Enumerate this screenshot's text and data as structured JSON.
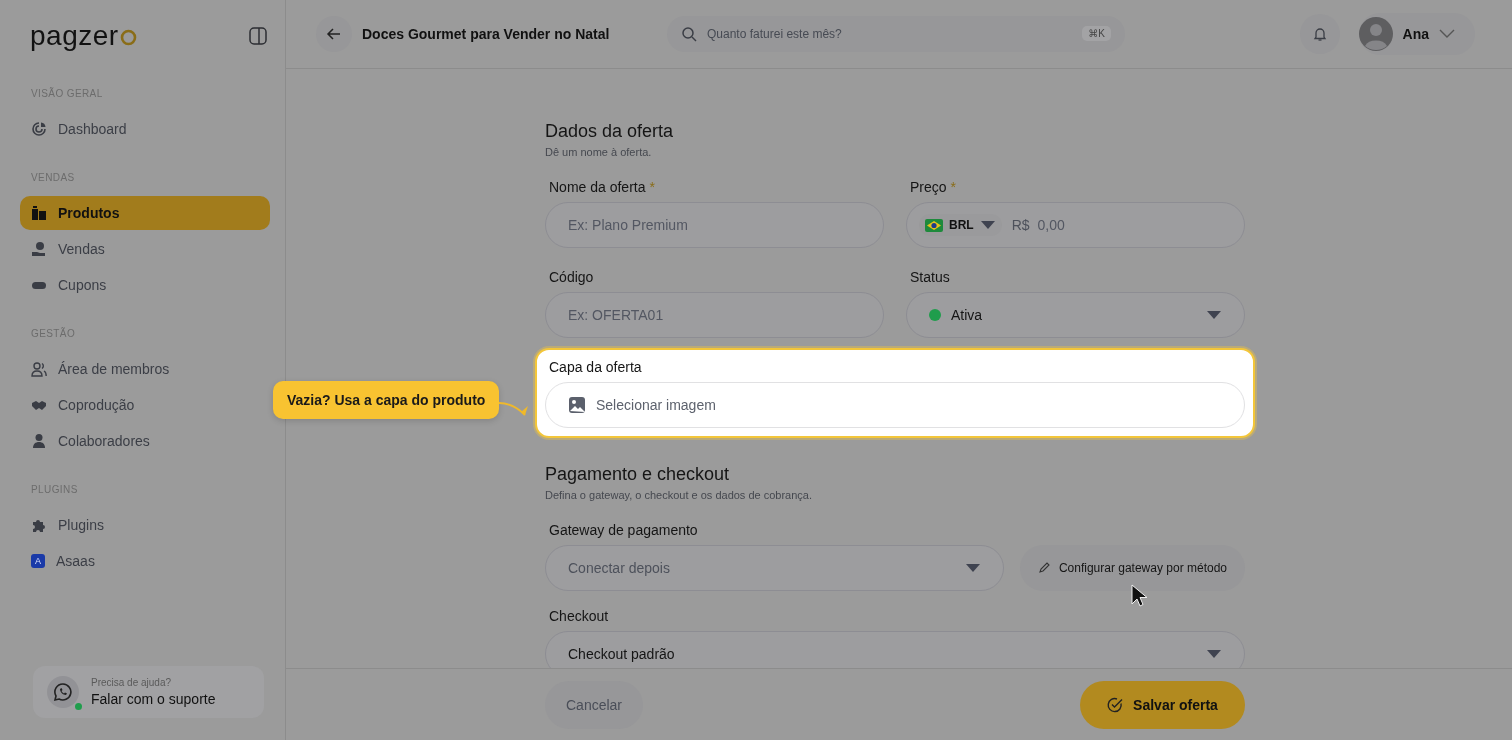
{
  "sidebar": {
    "logo": "pagzer",
    "sections": [
      {
        "title": "VISÃO GERAL",
        "items": [
          {
            "label": "Dashboard",
            "selected": false
          }
        ]
      },
      {
        "title": "VENDAS",
        "items": [
          {
            "label": "Produtos",
            "selected": true
          },
          {
            "label": "Vendas",
            "selected": false
          },
          {
            "label": "Cupons",
            "selected": false
          }
        ]
      },
      {
        "title": "GESTÃO",
        "items": [
          {
            "label": "Área de membros",
            "selected": false
          },
          {
            "label": "Coprodução",
            "selected": false
          },
          {
            "label": "Colaboradores",
            "selected": false
          }
        ]
      },
      {
        "title": "PLUGINS",
        "items": [
          {
            "label": "Plugins",
            "selected": false
          },
          {
            "label": "Asaas",
            "selected": false,
            "badge": "A"
          }
        ]
      }
    ],
    "support": {
      "hint": "Precisa de ajuda?",
      "label": "Falar com o suporte",
      "online": true
    }
  },
  "header": {
    "title": "Doces Gourmet para Vender no Natal",
    "search": {
      "placeholder": "Quanto faturei este mês?",
      "shortcut": "⌘K"
    },
    "user": "Ana"
  },
  "sections": [
    {
      "title": "Dados da oferta",
      "subtitle": "Dê um nome à oferta.",
      "rows": [
        [
          {
            "kind": "text",
            "label": "Nome da oferta",
            "required_mark": "*",
            "placeholder": "Ex: Plano Premium"
          },
          {
            "kind": "price",
            "label": "Preço",
            "required_mark": "*",
            "currency": "BRL",
            "symbol": "R$",
            "placeholder": "0,00"
          }
        ],
        [
          {
            "kind": "text",
            "label": "Código",
            "placeholder": "Ex: OFERTA01"
          },
          {
            "kind": "status",
            "label": "Status",
            "value": "Ativa",
            "color": "#1f9d4c"
          }
        ],
        [
          {
            "kind": "image",
            "label": "Capa da oferta",
            "highlighted": true,
            "placeholder": "Selecionar imagem"
          }
        ]
      ]
    },
    {
      "title": "Pagamento e checkout",
      "subtitle": "Defina o gateway, o checkout e os dados de cobrança.",
      "rows": [
        [
          {
            "kind": "select",
            "label": "Gateway de pagamento",
            "placeholder": "Conectar depois",
            "action": "Configurar gateway por método"
          }
        ],
        [
          {
            "kind": "select",
            "label": "Checkout",
            "value": "Checkout padrão"
          }
        ]
      ]
    }
  ],
  "tooltip": "Vazia? Usa a capa do produto",
  "footer": {
    "cancel": "Cancelar",
    "save": "Salvar oferta"
  }
}
